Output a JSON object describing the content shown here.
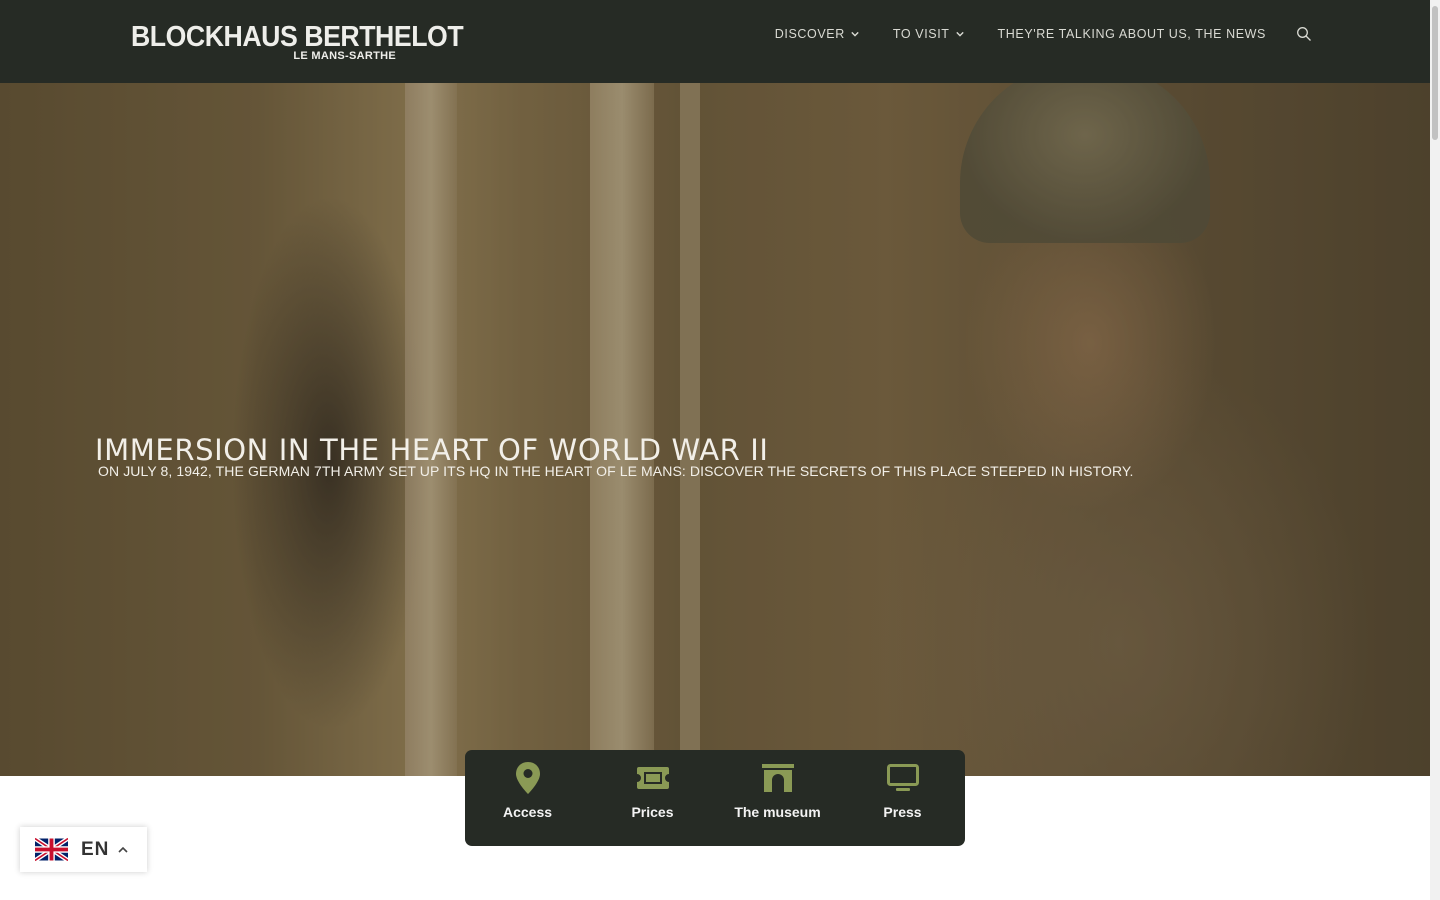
{
  "header": {
    "logo_main": "BLOCKHAUS BERTHELOT",
    "logo_sub": "LE MANS-SARTHE",
    "nav": [
      {
        "label": "DISCOVER",
        "has_dropdown": true
      },
      {
        "label": "TO VISIT",
        "has_dropdown": true
      },
      {
        "label": "THEY'RE TALKING ABOUT US, THE NEWS",
        "has_dropdown": false
      }
    ],
    "search_icon": "search-icon"
  },
  "hero": {
    "title": "IMMERSION IN THE HEART OF WORLD WAR II",
    "subtitle": "ON JULY 8, 1942, THE GERMAN 7TH ARMY SET UP ITS HQ IN THE HEART OF LE MANS: DISCOVER THE SECRETS OF THIS PLACE STEEPED IN HISTORY."
  },
  "quick_links": [
    {
      "label": "Access",
      "icon": "map-pin-icon"
    },
    {
      "label": "Prices",
      "icon": "ticket-icon"
    },
    {
      "label": "The museum",
      "icon": "archway-icon"
    },
    {
      "label": "Press",
      "icon": "monitor-icon"
    }
  ],
  "language": {
    "code": "EN",
    "flag": "uk-flag-icon"
  },
  "colors": {
    "header_bg": "#262b25",
    "accent_green": "#8a9a55",
    "text_light": "#f2efe8"
  }
}
